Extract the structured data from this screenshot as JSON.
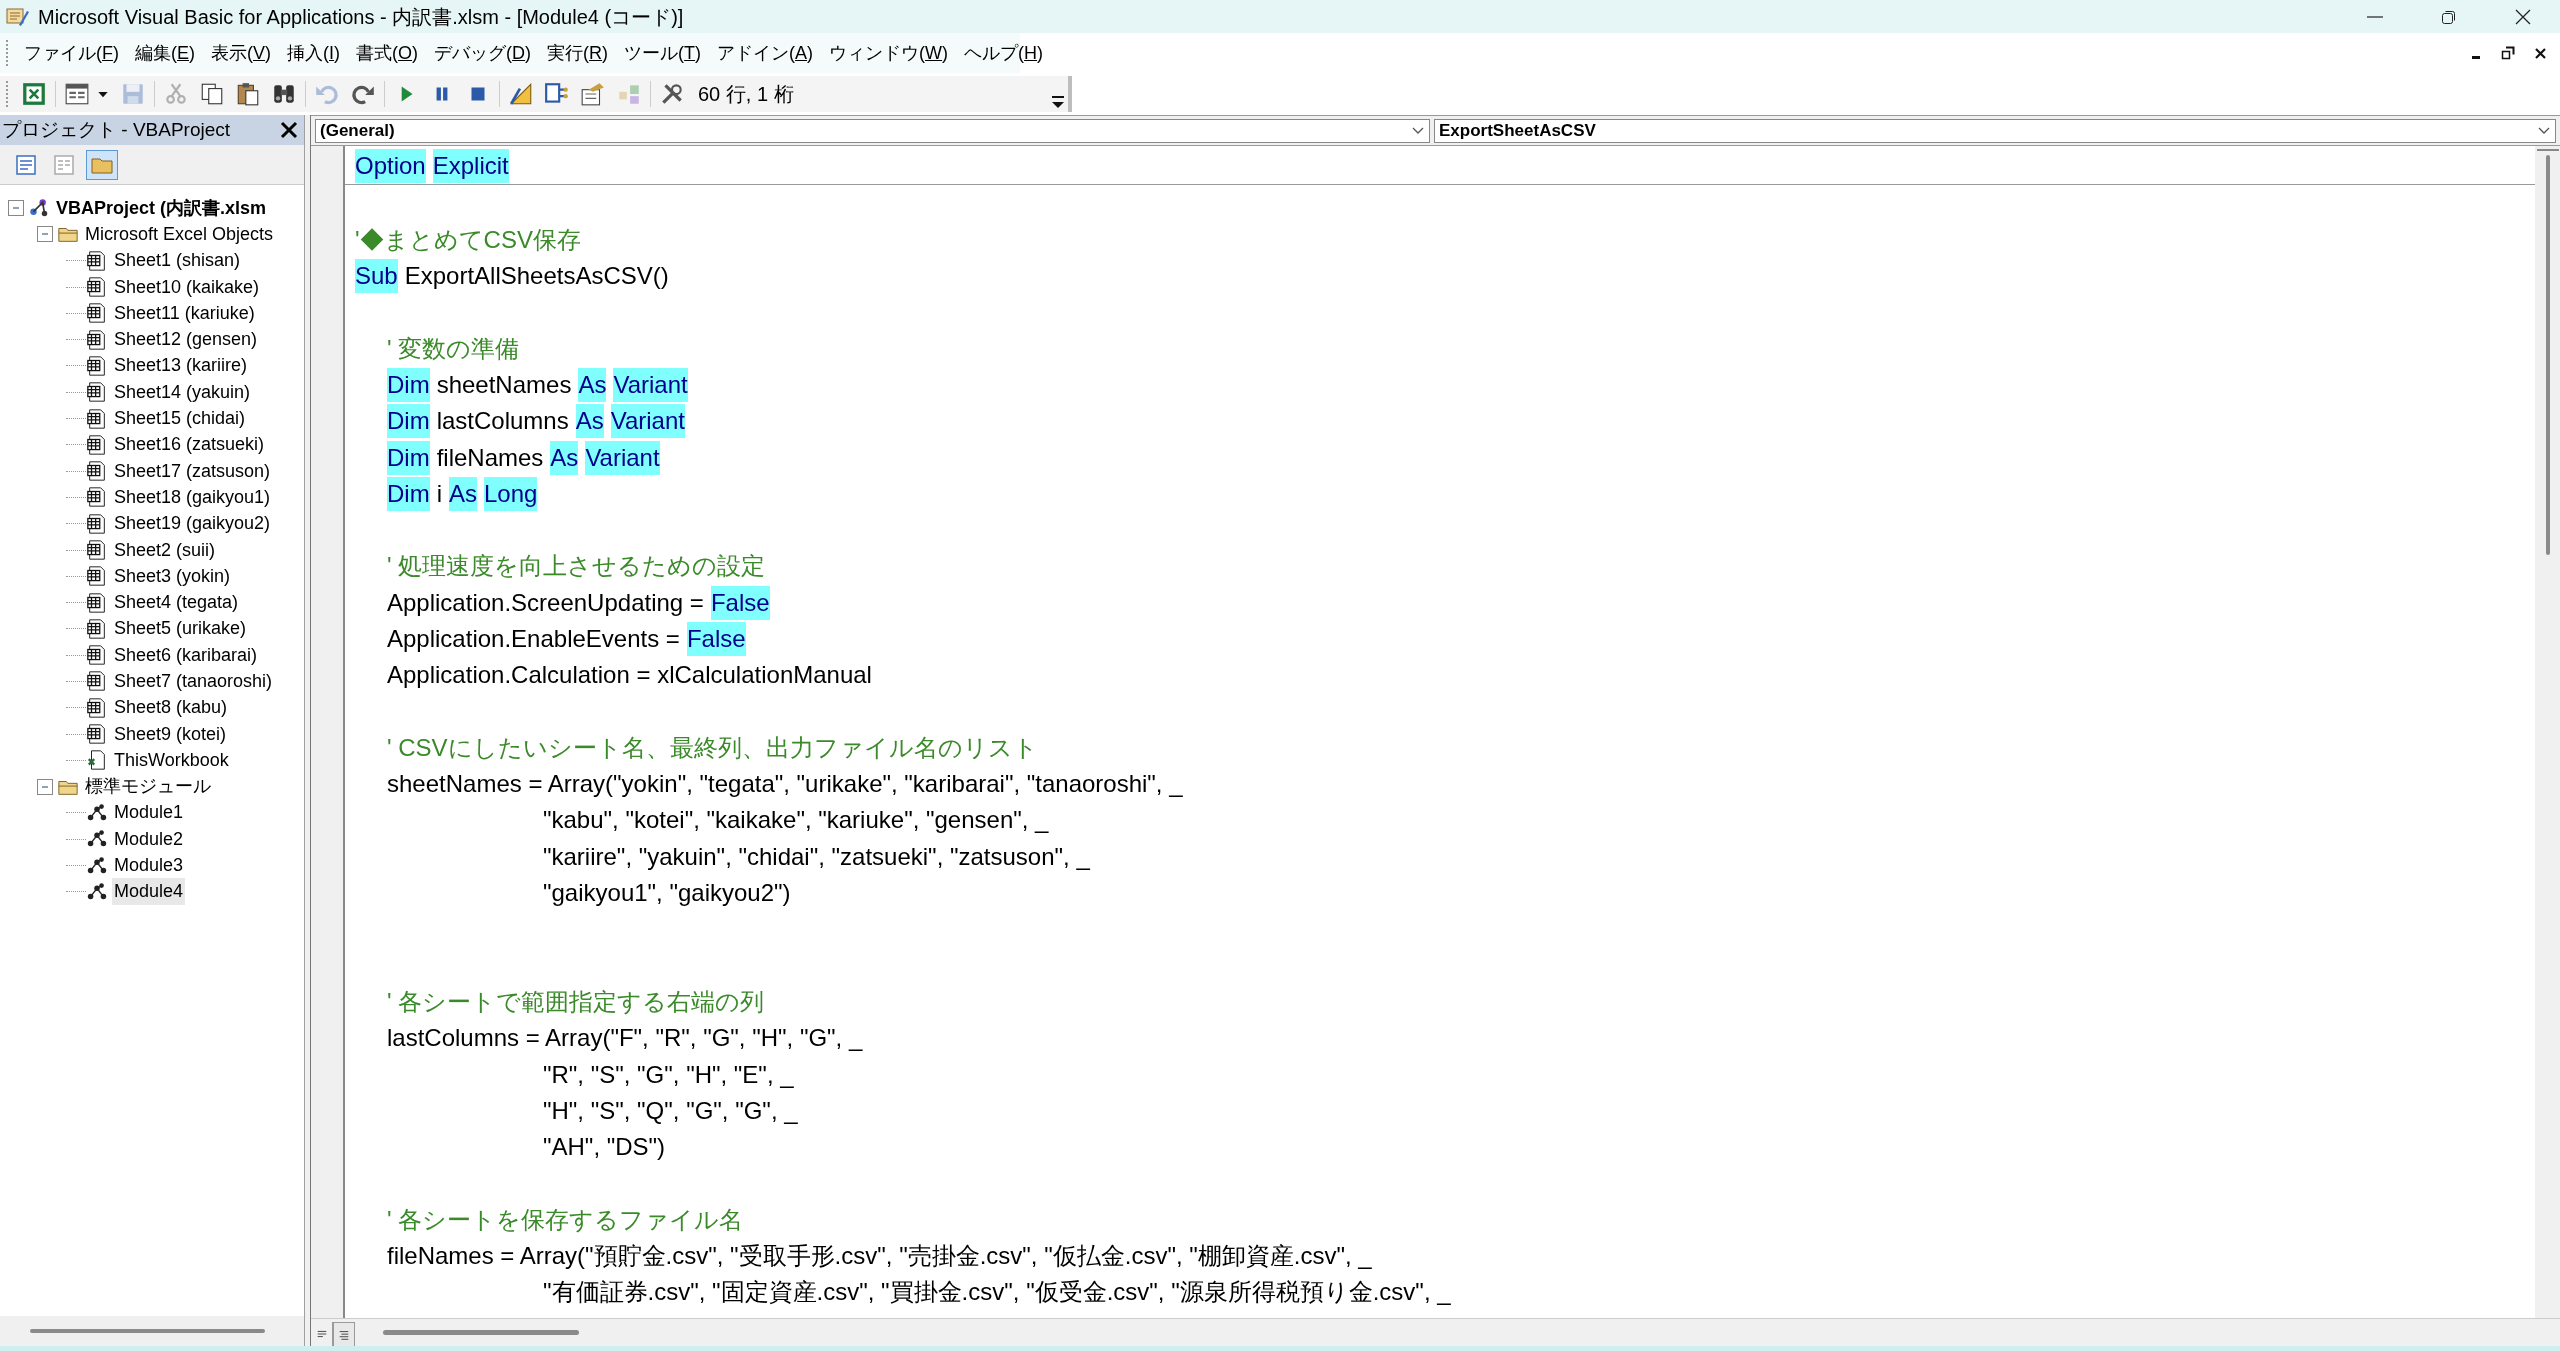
{
  "window": {
    "title": "Microsoft Visual Basic for Applications - 内訳書.xlsm - [Module4 (コード)]"
  },
  "menu": [
    {
      "before": "ファイル(",
      "key": "F",
      "after": ")"
    },
    {
      "before": "編集(",
      "key": "E",
      "after": ")"
    },
    {
      "before": "表示(",
      "key": "V",
      "after": ")"
    },
    {
      "before": "挿入(",
      "key": "I",
      "after": ")"
    },
    {
      "before": "書式(",
      "key": "O",
      "after": ")"
    },
    {
      "before": "デバッグ(",
      "key": "D",
      "after": ")"
    },
    {
      "before": "実行(",
      "key": "R",
      "after": ")"
    },
    {
      "before": "ツール(",
      "key": "T",
      "after": ")"
    },
    {
      "before": "アドイン(",
      "key": "A",
      "after": ")"
    },
    {
      "before": "ウィンドウ(",
      "key": "W",
      "after": ")"
    },
    {
      "before": "ヘルプ(",
      "key": "H",
      "after": ")"
    }
  ],
  "toolbar": {
    "buttons": [
      {
        "disabled": false
      },
      {
        "disabled": false
      },
      {
        "disabled": false
      },
      {
        "disabled": true
      },
      {
        "disabled": true
      },
      {
        "disabled": false
      },
      {
        "disabled": false
      },
      {
        "disabled": false
      },
      {
        "disabled": true
      },
      {
        "disabled": false
      },
      {
        "disabled": false
      },
      {
        "disabled": false
      },
      {
        "disabled": false
      },
      {
        "disabled": false
      },
      {
        "disabled": false
      },
      {
        "disabled": false
      },
      {
        "disabled": true
      },
      {
        "disabled": false
      }
    ],
    "position": "60 行, 1 桁"
  },
  "project_panel": {
    "title": "プロジェクト - VBAProject",
    "buttons": [
      {
        "pressed": false
      },
      {
        "pressed": false
      },
      {
        "pressed": true
      }
    ],
    "tree": [
      {
        "label": "VBAProject (内訳書.xlsm",
        "kind": "project",
        "expanded": true,
        "selected": false,
        "children": [
          {
            "label": "Microsoft Excel Objects",
            "kind": "folder",
            "expanded": true,
            "selected": false,
            "children": [
              {
                "label": "Sheet1 (shisan)",
                "kind": "sheet",
                "selected": false
              },
              {
                "label": "Sheet10 (kaikake)",
                "kind": "sheet",
                "selected": false
              },
              {
                "label": "Sheet11 (kariuke)",
                "kind": "sheet",
                "selected": false
              },
              {
                "label": "Sheet12 (gensen)",
                "kind": "sheet",
                "selected": false
              },
              {
                "label": "Sheet13 (kariire)",
                "kind": "sheet",
                "selected": false
              },
              {
                "label": "Sheet14 (yakuin)",
                "kind": "sheet",
                "selected": false
              },
              {
                "label": "Sheet15 (chidai)",
                "kind": "sheet",
                "selected": false
              },
              {
                "label": "Sheet16 (zatsueki)",
                "kind": "sheet",
                "selected": false
              },
              {
                "label": "Sheet17 (zatsuson)",
                "kind": "sheet",
                "selected": false
              },
              {
                "label": "Sheet18 (gaikyou1)",
                "kind": "sheet",
                "selected": false
              },
              {
                "label": "Sheet19 (gaikyou2)",
                "kind": "sheet",
                "selected": false
              },
              {
                "label": "Sheet2 (suii)",
                "kind": "sheet",
                "selected": false
              },
              {
                "label": "Sheet3 (yokin)",
                "kind": "sheet",
                "selected": false
              },
              {
                "label": "Sheet4 (tegata)",
                "kind": "sheet",
                "selected": false
              },
              {
                "label": "Sheet5 (urikake)",
                "kind": "sheet",
                "selected": false
              },
              {
                "label": "Sheet6 (karibarai)",
                "kind": "sheet",
                "selected": false
              },
              {
                "label": "Sheet7 (tanaoroshi)",
                "kind": "sheet",
                "selected": false
              },
              {
                "label": "Sheet8 (kabu)",
                "kind": "sheet",
                "selected": false
              },
              {
                "label": "Sheet9 (kotei)",
                "kind": "sheet",
                "selected": false
              },
              {
                "label": "ThisWorkbook",
                "kind": "workbook",
                "selected": false
              }
            ]
          },
          {
            "label": "標準モジュール",
            "kind": "folder",
            "expanded": true,
            "selected": false,
            "children": [
              {
                "label": "Module1",
                "kind": "module",
                "selected": false
              },
              {
                "label": "Module2",
                "kind": "module",
                "selected": false
              },
              {
                "label": "Module3",
                "kind": "module",
                "selected": false
              },
              {
                "label": "Module4",
                "kind": "module",
                "selected": true
              }
            ]
          }
        ]
      }
    ]
  },
  "object_combo": {
    "value": "(General)"
  },
  "procedure_combo": {
    "value": "ExportSheetAsCSV"
  },
  "code": {
    "lines": [
      {
        "kind": "top",
        "segments": [
          {
            "text": "Option",
            "kind": "keyword"
          },
          {
            "text": "Explicit",
            "kind": "keyword"
          }
        ]
      },
      {
        "kind": "separator"
      },
      {
        "kind": "blank"
      },
      {
        "kind": "top",
        "segments": [
          {
            "text": "'◆まとめてCSV保存",
            "kind": "comment"
          }
        ]
      },
      {
        "kind": "top",
        "segments": [
          {
            "text": "Sub",
            "kind": "keyword"
          },
          {
            "text": "ExportAllSheetsAsCSV()",
            "kind": "plain"
          }
        ]
      },
      {
        "kind": "blank"
      },
      {
        "kind": "body",
        "segments": [
          {
            "text": "' 変数の準備",
            "kind": "comment"
          }
        ]
      },
      {
        "kind": "body",
        "segments": [
          {
            "text": "Dim",
            "kind": "keyword"
          },
          {
            "text": "sheetNames",
            "kind": "plain"
          },
          {
            "text": "As",
            "kind": "keyword"
          },
          {
            "text": "Variant",
            "kind": "keyword"
          }
        ]
      },
      {
        "kind": "body",
        "segments": [
          {
            "text": "Dim",
            "kind": "keyword"
          },
          {
            "text": "lastColumns",
            "kind": "plain"
          },
          {
            "text": "As",
            "kind": "keyword"
          },
          {
            "text": "Variant",
            "kind": "keyword"
          }
        ]
      },
      {
        "kind": "body",
        "segments": [
          {
            "text": "Dim",
            "kind": "keyword"
          },
          {
            "text": "fileNames",
            "kind": "plain"
          },
          {
            "text": "As",
            "kind": "keyword"
          },
          {
            "text": "Variant",
            "kind": "keyword"
          }
        ]
      },
      {
        "kind": "body",
        "segments": [
          {
            "text": "Dim",
            "kind": "keyword"
          },
          {
            "text": "i",
            "kind": "plain"
          },
          {
            "text": "As",
            "kind": "keyword"
          },
          {
            "text": "Long",
            "kind": "keyword"
          }
        ]
      },
      {
        "kind": "blank"
      },
      {
        "kind": "body",
        "segments": [
          {
            "text": "' 処理速度を向上させるための設定",
            "kind": "comment"
          }
        ]
      },
      {
        "kind": "body",
        "segments": [
          {
            "text": "Application.ScreenUpdating =",
            "kind": "plain"
          },
          {
            "text": "False",
            "kind": "keyword"
          }
        ]
      },
      {
        "kind": "body",
        "segments": [
          {
            "text": "Application.EnableEvents =",
            "kind": "plain"
          },
          {
            "text": "False",
            "kind": "keyword"
          }
        ]
      },
      {
        "kind": "body",
        "segments": [
          {
            "text": "Application.Calculation = xlCalculationManual",
            "kind": "plain"
          }
        ]
      },
      {
        "kind": "blank"
      },
      {
        "kind": "body",
        "segments": [
          {
            "text": "' CSVにしたいシート名、最終列、出力ファイル名のリスト",
            "kind": "comment"
          }
        ]
      },
      {
        "kind": "body",
        "segments": [
          {
            "text": "sheetNames = Array(\"yokin\", \"tegata\", \"urikake\", \"karibarai\", \"tanaoroshi\", _",
            "kind": "plain"
          }
        ]
      },
      {
        "kind": "continuation",
        "segments": [
          {
            "text": "\"kabu\", \"kotei\", \"kaikake\", \"kariuke\", \"gensen\", _",
            "kind": "plain"
          }
        ]
      },
      {
        "kind": "continuation",
        "segments": [
          {
            "text": "\"kariire\", \"yakuin\", \"chidai\", \"zatsueki\", \"zatsuson\", _",
            "kind": "plain"
          }
        ]
      },
      {
        "kind": "continuation",
        "segments": [
          {
            "text": "\"gaikyou1\", \"gaikyou2\")",
            "kind": "plain"
          }
        ]
      },
      {
        "kind": "blank"
      },
      {
        "kind": "blank"
      },
      {
        "kind": "body",
        "segments": [
          {
            "text": "' 各シートで範囲指定する右端の列",
            "kind": "comment"
          }
        ]
      },
      {
        "kind": "body",
        "segments": [
          {
            "text": "lastColumns = Array(\"F\", \"R\", \"G\", \"H\", \"G\", _",
            "kind": "plain"
          }
        ]
      },
      {
        "kind": "continuation",
        "segments": [
          {
            "text": "\"R\", \"S\", \"G\", \"H\", \"E\", _",
            "kind": "plain"
          }
        ]
      },
      {
        "kind": "continuation",
        "segments": [
          {
            "text": "\"H\", \"S\", \"Q\", \"G\", \"G\", _",
            "kind": "plain"
          }
        ]
      },
      {
        "kind": "continuation",
        "segments": [
          {
            "text": "\"AH\", \"DS\")",
            "kind": "plain"
          }
        ]
      },
      {
        "kind": "blank"
      },
      {
        "kind": "body",
        "segments": [
          {
            "text": "' 各シートを保存するファイル名",
            "kind": "comment"
          }
        ]
      },
      {
        "kind": "body",
        "segments": [
          {
            "text": "fileNames = Array(\"預貯金.csv\", \"受取手形.csv\", \"売掛金.csv\", \"仮払金.csv\", \"棚卸資産.csv\", _",
            "kind": "plain"
          }
        ]
      },
      {
        "kind": "continuation",
        "segments": [
          {
            "text": "\"有価証券.csv\", \"固定資産.csv\", \"買掛金.csv\", \"仮受金.csv\", \"源泉所得税預り金.csv\", _",
            "kind": "plain"
          }
        ]
      }
    ]
  },
  "view_buttons": [
    {
      "selected": false
    },
    {
      "selected": true
    }
  ]
}
